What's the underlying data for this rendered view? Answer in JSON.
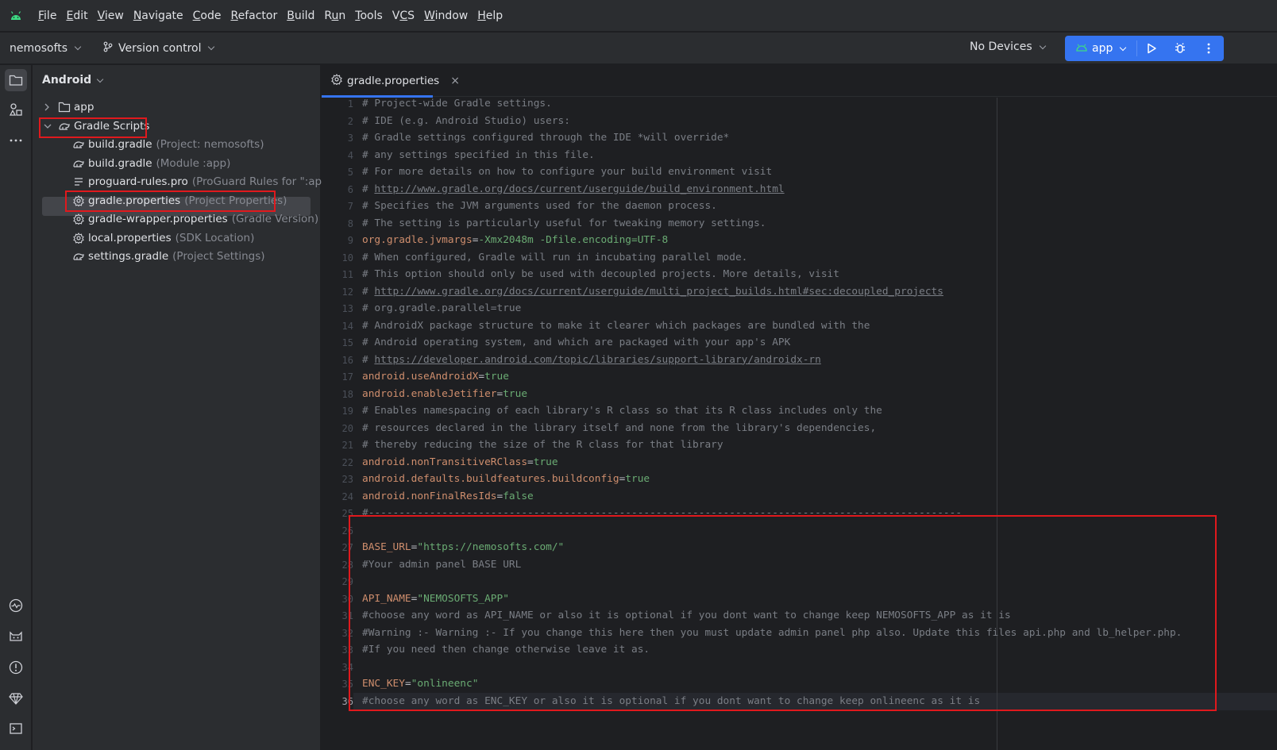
{
  "menubar": {
    "items": [
      {
        "label": "File",
        "mn": "F",
        "rest": "ile"
      },
      {
        "label": "Edit",
        "mn": "E",
        "rest": "dit"
      },
      {
        "label": "View",
        "mn": "V",
        "rest": "iew"
      },
      {
        "label": "Navigate",
        "mn": "N",
        "rest": "avigate"
      },
      {
        "label": "Code",
        "mn": "C",
        "rest": "ode"
      },
      {
        "label": "Refactor",
        "mn": "R",
        "rest": "efactor"
      },
      {
        "label": "Build",
        "mn": "B",
        "rest": "uild"
      },
      {
        "label": "Run",
        "mn": "R",
        "rest": "un",
        "mn_index": 1
      },
      {
        "label": "Tools",
        "mn": "T",
        "rest": "ools"
      },
      {
        "label": "VCS",
        "mn": "V",
        "rest": "CS",
        "mn_index": 1
      },
      {
        "label": "Window",
        "mn": "W",
        "rest": "indow"
      },
      {
        "label": "Help",
        "mn": "H",
        "rest": "elp"
      }
    ]
  },
  "toolbar": {
    "project": "nemosofts",
    "vcs": "Version control",
    "devices": "No Devices",
    "run_config": "app"
  },
  "project_panel": {
    "view": "Android",
    "tree": [
      {
        "name": "app",
        "hint": "",
        "icon": "folder-icon"
      },
      {
        "name": "Gradle Scripts",
        "hint": "",
        "icon": "gradle-icon"
      },
      {
        "name": "build.gradle",
        "hint": "(Project: nemosofts)",
        "icon": "gradle-icon"
      },
      {
        "name": "build.gradle",
        "hint": "(Module :app)",
        "icon": "gradle-icon"
      },
      {
        "name": "proguard-rules.pro",
        "hint": "(ProGuard Rules for \":app\")",
        "icon": "text-file-icon"
      },
      {
        "name": "gradle.properties",
        "hint": "(Project Properties)",
        "icon": "settings-file-icon"
      },
      {
        "name": "gradle-wrapper.properties",
        "hint": "(Gradle Version)",
        "icon": "settings-file-icon"
      },
      {
        "name": "local.properties",
        "hint": "(SDK Location)",
        "icon": "settings-file-icon"
      },
      {
        "name": "settings.gradle",
        "hint": "(Project Settings)",
        "icon": "gradle-icon"
      }
    ]
  },
  "editor": {
    "tab": "gradle.properties",
    "current_line": 36,
    "lines": [
      {
        "t": "comment",
        "text": "# Project-wide Gradle settings."
      },
      {
        "t": "comment",
        "text": "# IDE (e.g. Android Studio) users:"
      },
      {
        "t": "comment",
        "text": "# Gradle settings configured through the IDE *will override*"
      },
      {
        "t": "comment",
        "text": "# any settings specified in this file."
      },
      {
        "t": "comment",
        "text": "# For more details on how to configure your build environment visit"
      },
      {
        "t": "link",
        "prefix": "# ",
        "text": "http://www.gradle.org/docs/current/userguide/build_environment.html"
      },
      {
        "t": "comment",
        "text": "# Specifies the JVM arguments used for the daemon process."
      },
      {
        "t": "comment",
        "text": "# The setting is particularly useful for tweaking memory settings."
      },
      {
        "t": "prop",
        "key": "org.gradle.jvmargs",
        "value": "-Xmx2048m -Dfile.encoding=UTF-8"
      },
      {
        "t": "comment",
        "text": "# When configured, Gradle will run in incubating parallel mode."
      },
      {
        "t": "comment",
        "text": "# This option should only be used with decoupled projects. More details, visit"
      },
      {
        "t": "link",
        "prefix": "# ",
        "text": "http://www.gradle.org/docs/current/userguide/multi_project_builds.html#sec:decoupled_projects"
      },
      {
        "t": "comment",
        "text": "# org.gradle.parallel=true"
      },
      {
        "t": "comment",
        "text": "# AndroidX package structure to make it clearer which packages are bundled with the"
      },
      {
        "t": "comment",
        "text": "# Android operating system, and which are packaged with your app's APK"
      },
      {
        "t": "link",
        "prefix": "# ",
        "text": "https://developer.android.com/topic/libraries/support-library/androidx-rn"
      },
      {
        "t": "prop",
        "key": "android.useAndroidX",
        "value": "true"
      },
      {
        "t": "prop",
        "key": "android.enableJetifier",
        "value": "true"
      },
      {
        "t": "comment",
        "text": "# Enables namespacing of each library's R class so that its R class includes only the"
      },
      {
        "t": "comment",
        "text": "# resources declared in the library itself and none from the library's dependencies,"
      },
      {
        "t": "comment",
        "text": "# thereby reducing the size of the R class for that library"
      },
      {
        "t": "prop",
        "key": "android.nonTransitiveRClass",
        "value": "true"
      },
      {
        "t": "prop",
        "key": "android.defaults.buildfeatures.buildconfig",
        "value": "true"
      },
      {
        "t": "prop",
        "key": "android.nonFinalResIds",
        "value": "false"
      },
      {
        "t": "comment",
        "text": "#-------------------------------------------------------------------------------------------------"
      },
      {
        "t": "blank",
        "text": ""
      },
      {
        "t": "prop",
        "key": "BASE_URL",
        "value": "\"https://nemosofts.com/\""
      },
      {
        "t": "comment",
        "text": "#Your admin panel BASE URL"
      },
      {
        "t": "blank",
        "text": ""
      },
      {
        "t": "prop",
        "key": "API_NAME",
        "value": "\"NEMOSOFTS_APP\""
      },
      {
        "t": "comment",
        "text": "#choose any word as API_NAME or also it is optional if you dont want to change keep NEMOSOFTS_APP as it is"
      },
      {
        "t": "comment",
        "text": "#Warning :- Warning :- If you change this here then you must update admin panel php also. Update this files api.php and lb_helper.php."
      },
      {
        "t": "comment",
        "text": "#If you need then change otherwise leave it as."
      },
      {
        "t": "blank",
        "text": ""
      },
      {
        "t": "prop",
        "key": "ENC_KEY",
        "value": "\"onlineenc\""
      },
      {
        "t": "comment",
        "text": "#choose any word as ENC_KEY or also it is optional if you dont want to change keep onlineenc as it is"
      }
    ]
  }
}
